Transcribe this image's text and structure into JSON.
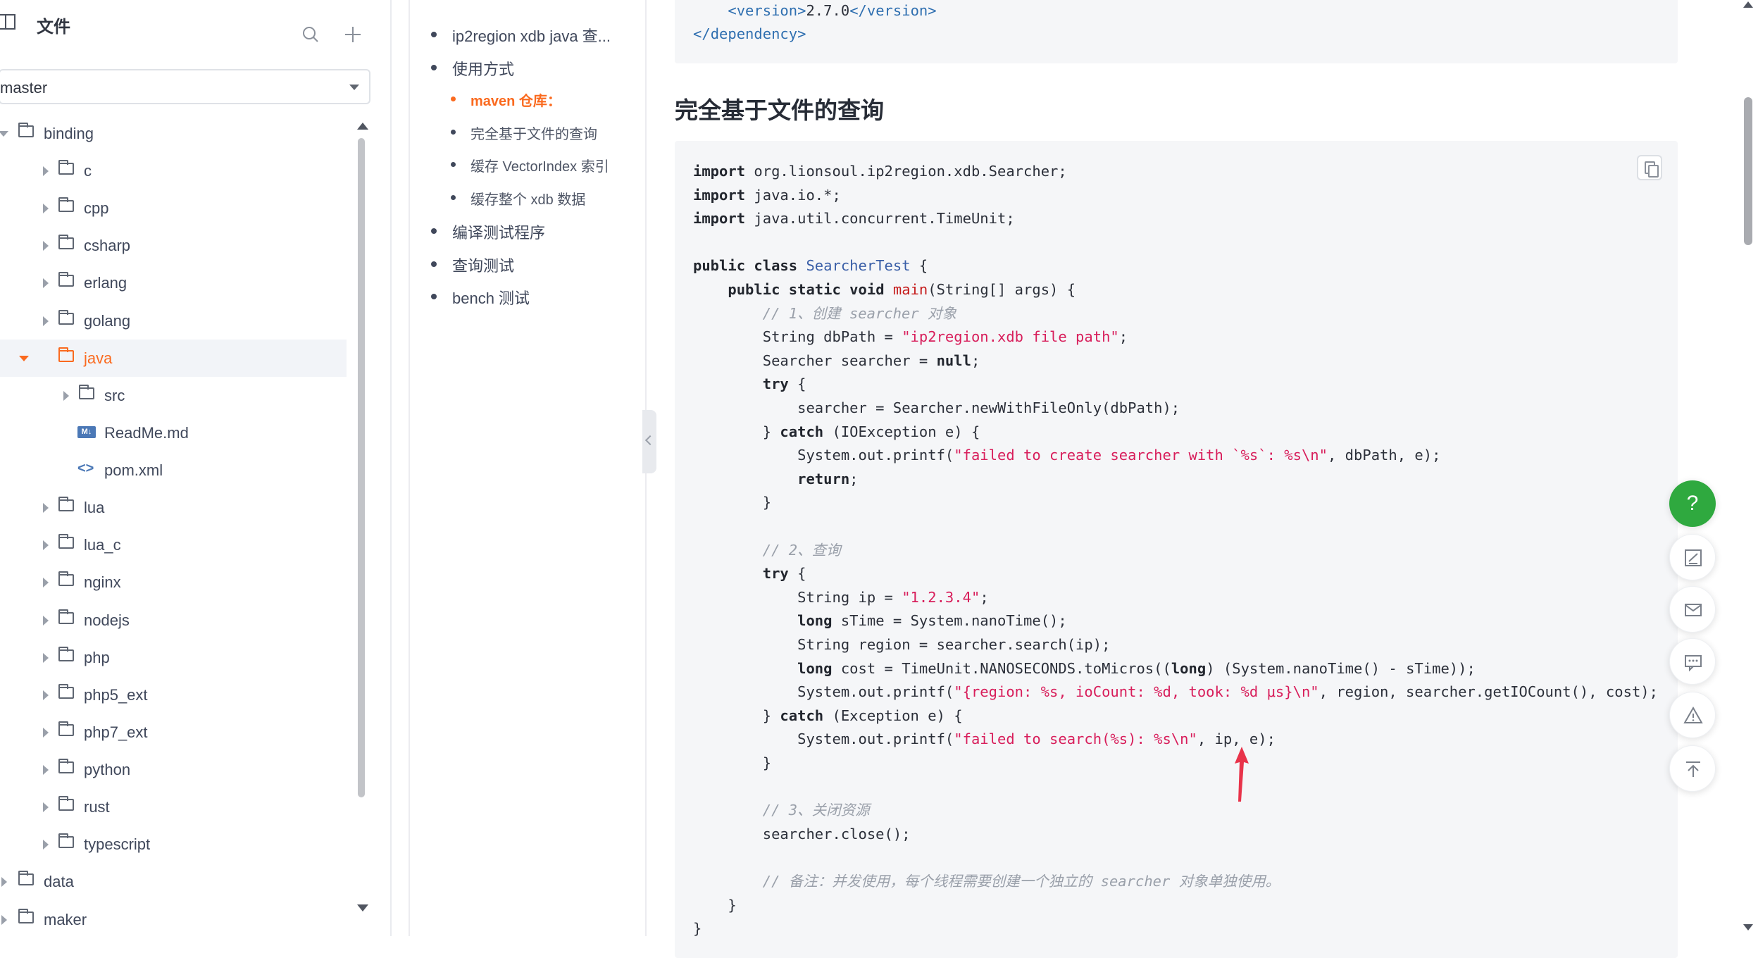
{
  "sidebar": {
    "title": "文件",
    "branch": "master",
    "tree": [
      {
        "label": "binding",
        "level": 0,
        "state": "open",
        "kind": "folder"
      },
      {
        "label": "c",
        "level": 1,
        "state": "closed",
        "kind": "folder"
      },
      {
        "label": "cpp",
        "level": 1,
        "state": "closed",
        "kind": "folder"
      },
      {
        "label": "csharp",
        "level": 1,
        "state": "closed",
        "kind": "folder"
      },
      {
        "label": "erlang",
        "level": 1,
        "state": "closed",
        "kind": "folder"
      },
      {
        "label": "golang",
        "level": 1,
        "state": "closed",
        "kind": "folder"
      },
      {
        "label": "java",
        "level": 1,
        "state": "open",
        "kind": "folder",
        "active": true
      },
      {
        "label": "src",
        "level": 2,
        "state": "closed",
        "kind": "folder"
      },
      {
        "label": "ReadMe.md",
        "level": 2,
        "state": "none",
        "kind": "markdown"
      },
      {
        "label": "pom.xml",
        "level": 2,
        "state": "none",
        "kind": "code"
      },
      {
        "label": "lua",
        "level": 1,
        "state": "closed",
        "kind": "folder"
      },
      {
        "label": "lua_c",
        "level": 1,
        "state": "closed",
        "kind": "folder"
      },
      {
        "label": "nginx",
        "level": 1,
        "state": "closed",
        "kind": "folder"
      },
      {
        "label": "nodejs",
        "level": 1,
        "state": "closed",
        "kind": "folder"
      },
      {
        "label": "php",
        "level": 1,
        "state": "closed",
        "kind": "folder"
      },
      {
        "label": "php5_ext",
        "level": 1,
        "state": "closed",
        "kind": "folder"
      },
      {
        "label": "php7_ext",
        "level": 1,
        "state": "closed",
        "kind": "folder"
      },
      {
        "label": "python",
        "level": 1,
        "state": "closed",
        "kind": "folder"
      },
      {
        "label": "rust",
        "level": 1,
        "state": "closed",
        "kind": "folder"
      },
      {
        "label": "typescript",
        "level": 1,
        "state": "closed",
        "kind": "folder"
      },
      {
        "label": "data",
        "level": 0,
        "state": "closed",
        "kind": "folder"
      },
      {
        "label": "maker",
        "level": 0,
        "state": "closed",
        "kind": "folder"
      }
    ]
  },
  "toc": [
    {
      "label": "ip2region xdb java 查...",
      "sub": false
    },
    {
      "label": "使用方式",
      "sub": false
    },
    {
      "label": "maven 仓库：",
      "sub": true,
      "active": true
    },
    {
      "label": "完全基于文件的查询",
      "sub": true
    },
    {
      "label": "缓存 VectorIndex 索引",
      "sub": true
    },
    {
      "label": "缓存整个 xdb 数据",
      "sub": true
    },
    {
      "label": "编译测试程序",
      "sub": false
    },
    {
      "label": "查询测试",
      "sub": false
    },
    {
      "label": "bench 测试",
      "sub": false
    }
  ],
  "main": {
    "heading": "完全基于文件的查询",
    "top_code": [
      [
        [
          "    ",
          ""
        ],
        [
          "<",
          "tag"
        ],
        [
          "version",
          "tag"
        ],
        [
          ">",
          "tag"
        ],
        [
          "2.7.0",
          ""
        ],
        [
          "</",
          "tag"
        ],
        [
          "version",
          "tag"
        ],
        [
          ">",
          "tag"
        ]
      ],
      [
        [
          "</",
          "tag"
        ],
        [
          "dependency",
          "tag"
        ],
        [
          ">",
          "tag"
        ]
      ]
    ],
    "code": [
      [
        [
          "import",
          "kw"
        ],
        [
          " org.lionsoul.ip2region.xdb.Searcher;",
          ""
        ]
      ],
      [
        [
          "import",
          "kw"
        ],
        [
          " java.io.*;",
          ""
        ]
      ],
      [
        [
          "import",
          "kw"
        ],
        [
          " java.util.concurrent.TimeUnit;",
          ""
        ]
      ],
      [
        [
          "",
          ""
        ]
      ],
      [
        [
          "public class",
          "kw"
        ],
        [
          " ",
          ""
        ],
        [
          "SearcherTest",
          "ty"
        ],
        [
          " {",
          ""
        ]
      ],
      [
        [
          "    ",
          ""
        ],
        [
          "public static void",
          "kw"
        ],
        [
          " ",
          ""
        ],
        [
          "main",
          "fn"
        ],
        [
          "(String[] args) {",
          ""
        ]
      ],
      [
        [
          "        ",
          ""
        ],
        [
          "// 1、创建 searcher 对象",
          "cm"
        ]
      ],
      [
        [
          "        String dbPath = ",
          ""
        ],
        [
          "\"ip2region.xdb file path\"",
          "str"
        ],
        [
          ";",
          ""
        ]
      ],
      [
        [
          "        Searcher searcher = ",
          ""
        ],
        [
          "null",
          "kw"
        ],
        [
          ";",
          ""
        ]
      ],
      [
        [
          "        ",
          ""
        ],
        [
          "try",
          "kw"
        ],
        [
          " {",
          ""
        ]
      ],
      [
        [
          "            searcher = Searcher.newWithFileOnly(dbPath);",
          ""
        ]
      ],
      [
        [
          "        } ",
          ""
        ],
        [
          "catch",
          "kw"
        ],
        [
          " (IOException e) {",
          ""
        ]
      ],
      [
        [
          "            System.out.printf(",
          ""
        ],
        [
          "\"failed to create searcher with `%s`: %s\\n\"",
          "str"
        ],
        [
          ", dbPath, e);",
          ""
        ]
      ],
      [
        [
          "            ",
          ""
        ],
        [
          "return",
          "kw"
        ],
        [
          ";",
          ""
        ]
      ],
      [
        [
          "        }",
          ""
        ]
      ],
      [
        [
          "",
          ""
        ]
      ],
      [
        [
          "        ",
          ""
        ],
        [
          "// 2、查询",
          "cm"
        ]
      ],
      [
        [
          "        ",
          ""
        ],
        [
          "try",
          "kw"
        ],
        [
          " {",
          ""
        ]
      ],
      [
        [
          "            String ip = ",
          ""
        ],
        [
          "\"1.2.3.4\"",
          "str"
        ],
        [
          ";",
          ""
        ]
      ],
      [
        [
          "            ",
          ""
        ],
        [
          "long",
          "kw"
        ],
        [
          " sTime = System.nanoTime();",
          ""
        ]
      ],
      [
        [
          "            String region = searcher.search(ip);",
          ""
        ]
      ],
      [
        [
          "            ",
          ""
        ],
        [
          "long",
          "kw"
        ],
        [
          " cost = TimeUnit.NANOSECONDS.toMicros((",
          ""
        ],
        [
          "long",
          "kw"
        ],
        [
          ") (System.nanoTime() - sTime));",
          ""
        ]
      ],
      [
        [
          "            System.out.printf(",
          ""
        ],
        [
          "\"{region: %s, ioCount: %d, took: %d μs}\\n\"",
          "str"
        ],
        [
          ", region, searcher.getIOCount(), cost);",
          ""
        ]
      ],
      [
        [
          "        } ",
          ""
        ],
        [
          "catch",
          "kw"
        ],
        [
          " (Exception e) {",
          ""
        ]
      ],
      [
        [
          "            System.out.printf(",
          ""
        ],
        [
          "\"failed to search(%s): %s\\n\"",
          "str"
        ],
        [
          ", ip, e);",
          ""
        ]
      ],
      [
        [
          "        }",
          ""
        ]
      ],
      [
        [
          "",
          ""
        ]
      ],
      [
        [
          "        ",
          ""
        ],
        [
          "// 3、关闭资源",
          "cm"
        ]
      ],
      [
        [
          "        searcher.close();",
          ""
        ]
      ],
      [
        [
          "",
          ""
        ]
      ],
      [
        [
          "        ",
          ""
        ],
        [
          "// 备注：并发使用，每个线程需要创建一个独立的 searcher 对象单独使用。",
          "cm"
        ]
      ],
      [
        [
          "    }",
          ""
        ]
      ],
      [
        [
          "}",
          ""
        ]
      ]
    ]
  },
  "float_buttons": {
    "help": "?",
    "items": [
      "edit-icon",
      "mail-icon",
      "comment-icon",
      "warning-icon",
      "back-to-top-icon"
    ]
  },
  "colors": {
    "accent": "#fa6a1f",
    "help_button": "#2fa93f",
    "string": "#d81e5b",
    "comment": "#9aa0aa"
  }
}
